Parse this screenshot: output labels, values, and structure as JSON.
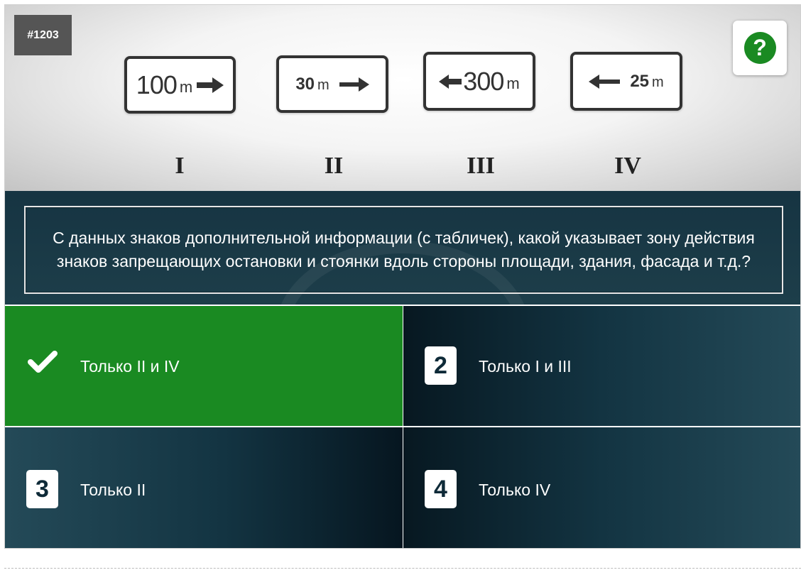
{
  "question_number": "#1203",
  "help_icon_text": "?",
  "signs": [
    {
      "value": "100",
      "unit": "m",
      "arrow": "right",
      "label": "I"
    },
    {
      "value": "30",
      "unit": "m",
      "arrow": "right",
      "label": "II"
    },
    {
      "value": "300",
      "unit": "m",
      "arrow": "left",
      "label": "III"
    },
    {
      "value": "25",
      "unit": "m",
      "arrow": "left",
      "label": "IV"
    }
  ],
  "question": "С данных знаков дополнительной информации (с табличек), какой указывает зону действия знаков запрещающих остановки и стоянки вдоль стороны площади, здания, фасада и т.д.?",
  "answers": [
    {
      "marker": "check",
      "text": "Только II и IV",
      "state": "correct"
    },
    {
      "marker": "2",
      "text": "Только I и III",
      "state": "default"
    },
    {
      "marker": "3",
      "text": "Только II",
      "state": "default"
    },
    {
      "marker": "4",
      "text": "Только IV",
      "state": "default"
    }
  ],
  "colors": {
    "correct": "#1a8a22",
    "dark": "#133442",
    "help": "#1a8a22"
  }
}
